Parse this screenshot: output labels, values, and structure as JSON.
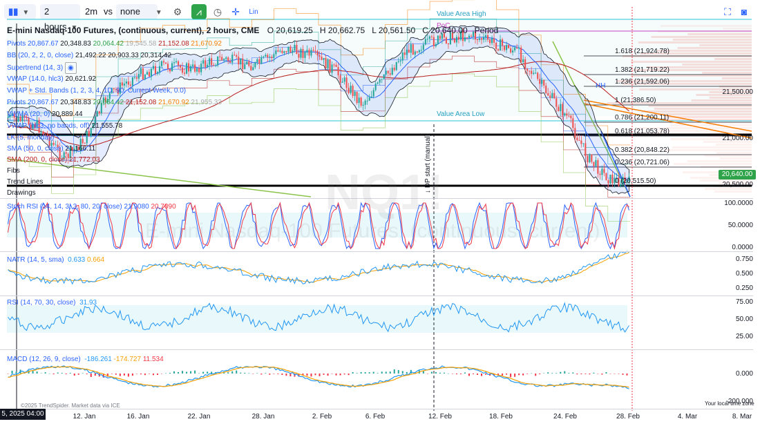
{
  "toolbar": {
    "chart_type_icon": "candlestick-icon",
    "interval": "2 hours",
    "replay_interval": "2m",
    "vs_label": "vs",
    "compare": "none",
    "lin_label": "Lin",
    "fullscreen_icon": "fullscreen-icon",
    "snapshot_icon": "camera-icon"
  },
  "header": {
    "title": "E-mini Nasdaq-100 Futures, (continuous, current), 2 hours, CME",
    "o_label": "O",
    "o": "20,619.25",
    "h_label": "H",
    "h": "20,662.75",
    "l_label": "L",
    "l": "20,561.50",
    "c_label": "C",
    "c": "20,640.00",
    "period_label": "Period"
  },
  "legend": {
    "pivots1": {
      "name": "Pivots",
      "v1": "20,867.67",
      "v2": "20,348.83",
      "v3": "20,064.42",
      "v4": "19,545.58",
      "v5": "21,152.08",
      "v6": "21,670.92"
    },
    "bb": {
      "name": "BB (20, 2, 2, 0, close)",
      "v1": "21,492.22",
      "v2": "20,903.33",
      "v3": "20,314.42"
    },
    "supertrend": {
      "name": "Supertrend (14, 3)"
    },
    "vwap": {
      "name": "VWAP (14.0, hlc3)",
      "v1": "20,621.92"
    },
    "vwap_bands": {
      "name": "VWAP + Std. Bands (1, 2, 3, 4, 1D, 90, Current Week, 0.0)"
    },
    "pivots2": {
      "name": "Pivots",
      "v1": "20,867.67",
      "v2": "20,348.83",
      "v3": "20,064.42",
      "v4": "21,152.08",
      "v5": "21,670.92",
      "v6": "21,955.33"
    },
    "vwma": {
      "name": "VWMA (20, 0)",
      "v1": "20,889.44"
    },
    "vwap_no_bands": {
      "name": "VWAP (hlc3, no bands, off)",
      "v1": "21,555.78"
    },
    "lk": {
      "name": "LK (5, monday)"
    },
    "sma50": {
      "name": "SMA (50, 0, close)",
      "v1": "21,166.11"
    },
    "sma200": {
      "name": "SMA (200, 0, close)",
      "v1": "21,772.03"
    },
    "fibs": {
      "name": "Fibs"
    },
    "trend_lines": {
      "name": "Trend Lines"
    },
    "drawings": {
      "name": "Drawings"
    }
  },
  "annotations": {
    "value_area_high": "Value Area High",
    "poc": "PoC",
    "value_area_low": "Value Area Low",
    "hh": "HH",
    "dp_start": "↓ DP start (manual)",
    "watermark_symbol": "NQ1!",
    "watermark_name": "E-mini Nasdaq-100 Futures, (continuous, current)"
  },
  "fibs": [
    {
      "label": "1.618 (21,924.78)"
    },
    {
      "label": "1.382 (21,719.22)"
    },
    {
      "label": "1.236 (21,592.06)"
    },
    {
      "label": "1 (21,386.50)"
    },
    {
      "label": "0.786 (21,200.11)"
    },
    {
      "label": "0.618 (21,053.78)"
    },
    {
      "label": "0.382 (20,848.22)"
    },
    {
      "label": "0.236 (20,721.06)"
    },
    {
      "label": "0 (20,515.50)"
    }
  ],
  "price_axis": {
    "labels": [
      "21,500.00",
      "21,000.00",
      "20,500.00"
    ],
    "last_price": "20,640.00"
  },
  "stoch_rsi": {
    "name": "Stoch RSI (14, 14, 3, 3, 80, 20, close)",
    "v1": "21.9080",
    "v2": "20.7090",
    "axis": [
      "100.0000",
      "50.0000",
      "0.0000"
    ],
    "k_color": "#2962ff",
    "d_color": "#f23645"
  },
  "natr": {
    "name": "NATR (14, 5, sma)",
    "v1": "0.633",
    "v2": "0.664",
    "axis": [
      "0.750",
      "0.500",
      "0.250"
    ]
  },
  "rsi": {
    "name": "RSI (14, 70, 30, close)",
    "v1": "31.93",
    "axis": [
      "75.00",
      "50.00",
      "25.00"
    ]
  },
  "macd": {
    "name": "MACD (12, 26, 9, close)",
    "v1": "-186.261",
    "v2": "-174.727",
    "v3": "11.534",
    "axis": [
      "0.000",
      "-200.000"
    ],
    "copyright": "©2025 TrendSpider. Market data via ICE",
    "local_time": "Your local time zone"
  },
  "time_axis": {
    "labels": [
      "12. Jan",
      "16. Jan",
      "22. Jan",
      "28. Jan",
      "2. Feb",
      "6. Feb",
      "12. Feb",
      "18. Feb",
      "24. Feb",
      "28. Feb",
      "4. Mar",
      "8. Mar"
    ],
    "cursor_time": "5, 2025 04:00"
  },
  "colors": {
    "up": "#26a69a",
    "down": "#ef5350",
    "accent": "#2962ff",
    "green_btn": "#2fa34a"
  }
}
